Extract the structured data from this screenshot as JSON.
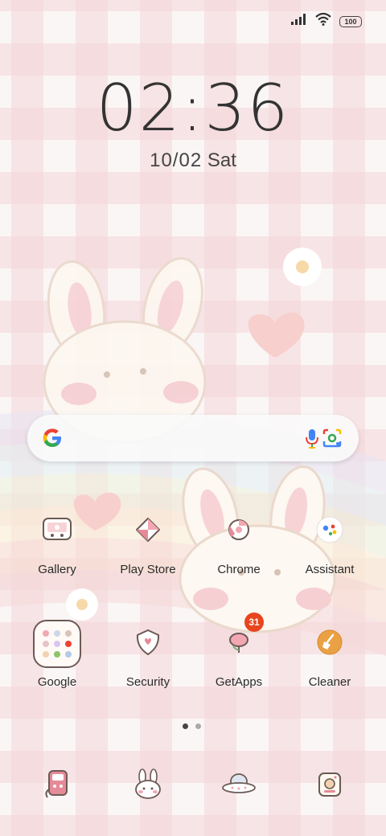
{
  "status_bar": {
    "battery": "100"
  },
  "lockscreen": {
    "time": "02:36",
    "date": "10/02",
    "day": "Sat"
  },
  "apps": {
    "gallery": "Gallery",
    "play_store": "Play Store",
    "chrome": "Chrome",
    "assistant": "Assistant",
    "google": "Google",
    "security": "Security",
    "getapps": "GetApps",
    "getapps_badge": "31",
    "cleaner": "Cleaner"
  },
  "colors": {
    "badge": "#e8451e",
    "accent_pink": "#f2a7b3"
  }
}
